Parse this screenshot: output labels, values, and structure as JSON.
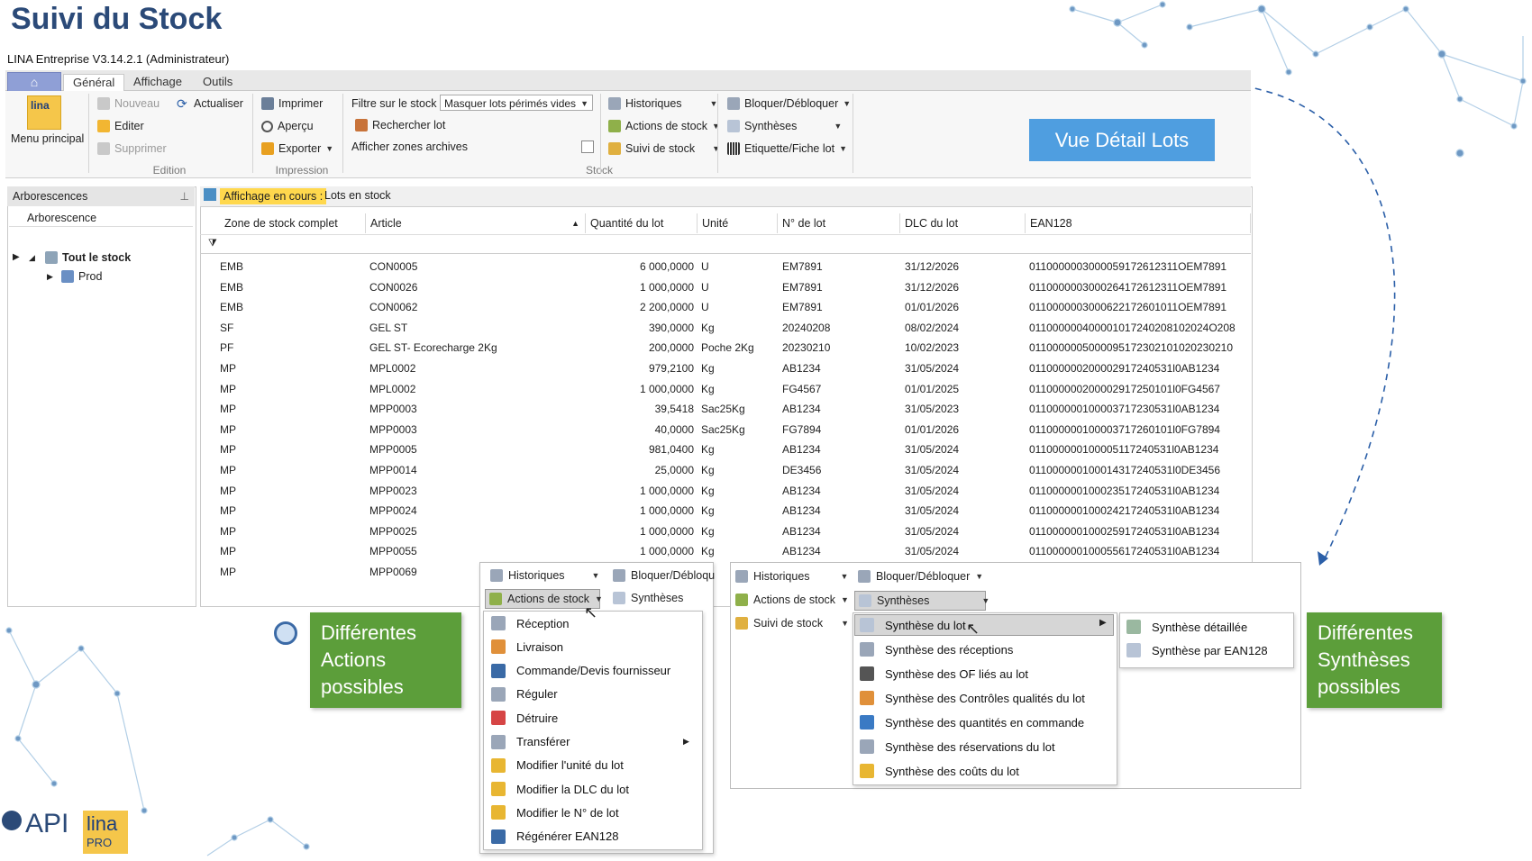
{
  "slide": {
    "title": "Suivi du Stock",
    "badge": "Vue Détail Lots"
  },
  "app": {
    "title": "LINA Entreprise  V3.14.2.1  (Administrateur)"
  },
  "tabs": [
    "Général",
    "Affichage",
    "Outils"
  ],
  "ribbon": {
    "menu_principal": "Menu principal",
    "edition": {
      "nouveau": "Nouveau",
      "actualiser": "Actualiser",
      "editer": "Editer",
      "supprimer": "Supprimer",
      "label": "Edition"
    },
    "impression": {
      "imprimer": "Imprimer",
      "apercu": "Aperçu",
      "exporter": "Exporter",
      "label": "Impression"
    },
    "stock": {
      "filtre_label": "Filtre sur le stock :",
      "filtre_value": "Masquer lots périmés vides",
      "rechercher": "Rechercher lot",
      "archives": "Afficher zones archives",
      "label": "Stock"
    },
    "actions": {
      "historiques": "Historiques",
      "actions_stock": "Actions de stock",
      "suivi": "Suivi de stock",
      "bloquer": "Bloquer/Débloquer",
      "syntheses": "Synthèses",
      "etiquette": "Etiquette/Fiche lot"
    }
  },
  "left_panel": {
    "header": "Arborescences",
    "column": "Arborescence",
    "root": "Tout le stock",
    "child": "Prod"
  },
  "grid": {
    "display_label": "Affichage en cours :",
    "display_value": "Lots en stock",
    "columns": [
      "Zone de stock complet",
      "Article",
      "Quantité du lot",
      "Unité",
      "N° de lot",
      "DLC du lot",
      "EAN128"
    ],
    "rows": [
      [
        "EMB",
        "CON0005",
        "6 000,0000",
        "U",
        "EM7891",
        "31/12/2026",
        "0110000003000059172612311OEM7891"
      ],
      [
        "EMB",
        "CON0026",
        "1 000,0000",
        "U",
        "EM7891",
        "31/12/2026",
        "0110000003000264172612311OEM7891"
      ],
      [
        "EMB",
        "CON0062",
        "2 200,0000",
        "U",
        "EM7891",
        "01/01/2026",
        "0110000003000622172601011OEM7891"
      ],
      [
        "SF",
        "GEL ST",
        "390,0000",
        "Kg",
        "20240208",
        "08/02/2024",
        "011000000400001017240208102024O208"
      ],
      [
        "PF",
        "GEL ST- Ecorecharge 2Kg",
        "200,0000",
        "Poche 2Kg",
        "20230210",
        "10/02/2023",
        "0110000005000095172302101020230210"
      ],
      [
        "MP",
        "MPL0002",
        "979,2100",
        "Kg",
        "AB1234",
        "31/05/2024",
        "011000000200002917240531l0AB1234"
      ],
      [
        "MP",
        "MPL0002",
        "1 000,0000",
        "Kg",
        "FG4567",
        "01/01/2025",
        "011000000200002917250101l0FG4567"
      ],
      [
        "MP",
        "MPP0003",
        "39,5418",
        "Sac25Kg",
        "AB1234",
        "31/05/2023",
        "011000000100003717230531l0AB1234"
      ],
      [
        "MP",
        "MPP0003",
        "40,0000",
        "Sac25Kg",
        "FG7894",
        "01/01/2026",
        "011000000100003717260101l0FG7894"
      ],
      [
        "MP",
        "MPP0005",
        "981,0400",
        "Kg",
        "AB1234",
        "31/05/2024",
        "011000000100005117240531l0AB1234"
      ],
      [
        "MP",
        "MPP0014",
        "25,0000",
        "Kg",
        "DE3456",
        "31/05/2024",
        "011000000100014317240531l0DE3456"
      ],
      [
        "MP",
        "MPP0023",
        "1 000,0000",
        "Kg",
        "AB1234",
        "31/05/2024",
        "011000000100023517240531l0AB1234"
      ],
      [
        "MP",
        "MPP0024",
        "1 000,0000",
        "Kg",
        "AB1234",
        "31/05/2024",
        "011000000100024217240531l0AB1234"
      ],
      [
        "MP",
        "MPP0025",
        "1 000,0000",
        "Kg",
        "AB1234",
        "31/05/2024",
        "011000000100025917240531l0AB1234"
      ],
      [
        "MP",
        "MPP0055",
        "1 000,0000",
        "Kg",
        "AB1234",
        "31/05/2024",
        "011000000100055617240531l0AB1234"
      ],
      [
        "MP",
        "MPP0069",
        "",
        "",
        "",
        "",
        ""
      ]
    ]
  },
  "popup1": {
    "historiques": "Historiques",
    "bloquer": "Bloquer/Débloqu",
    "actions_stock": "Actions de stock",
    "syntheses": "Synthèses",
    "items": [
      "Réception",
      "Livraison",
      "Commande/Devis fournisseur",
      "Réguler",
      "Détruire",
      "Transférer",
      "Modifier l'unité du lot",
      "Modifier la DLC du lot",
      "Modifier le N° de lot",
      "Régénérer EAN128"
    ]
  },
  "popup2": {
    "historiques": "Historiques",
    "bloquer": "Bloquer/Débloquer",
    "actions_stock": "Actions de stock",
    "syntheses": "Synthèses",
    "suivi": "Suivi de stock",
    "items": [
      "Synthèse du lot",
      "Synthèse des réceptions",
      "Synthèse des OF liés au lot",
      "Synthèse des Contrôles qualités du lot",
      "Synthèse des quantités en commande",
      "Synthèse des réservations du lot",
      "Synthèse des coûts du lot"
    ],
    "submenu": [
      "Synthèse détaillée",
      "Synthèse par EAN128"
    ]
  },
  "callouts": {
    "left": "Différentes Actions possibles",
    "right": "Différentes Synthèses possibles"
  },
  "logos": {
    "api": "API",
    "lina": "lina",
    "pro": "PRO"
  },
  "colors": {
    "title": "#2b4a78",
    "badge": "#4f9ee0",
    "callout": "#5c9e3a",
    "highlight": "#ffd84d"
  }
}
